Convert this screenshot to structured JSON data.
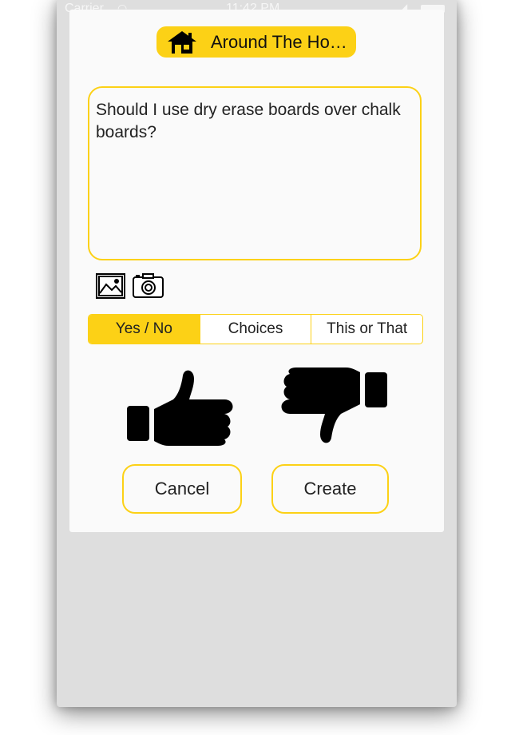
{
  "status_bar": {
    "carrier": "Carrier",
    "time": "11:42 PM"
  },
  "category": {
    "label": "Around The Ho…",
    "icon": "house-icon"
  },
  "question": {
    "text": "Should I use dry erase boards over chalk boards?"
  },
  "media": {
    "image_icon": "image-icon",
    "camera_icon": "camera-icon"
  },
  "segments": [
    "Yes / No",
    "Choices",
    "This or That"
  ],
  "selected_segment": "Yes / No",
  "vote_icons": [
    "thumbs-up-icon",
    "thumbs-down-icon"
  ],
  "buttons": {
    "cancel": "Cancel",
    "create": "Create"
  },
  "colors": {
    "accent": "#fcd116",
    "background": "#dedede",
    "card": "#fafafa",
    "icon": "#000000"
  }
}
